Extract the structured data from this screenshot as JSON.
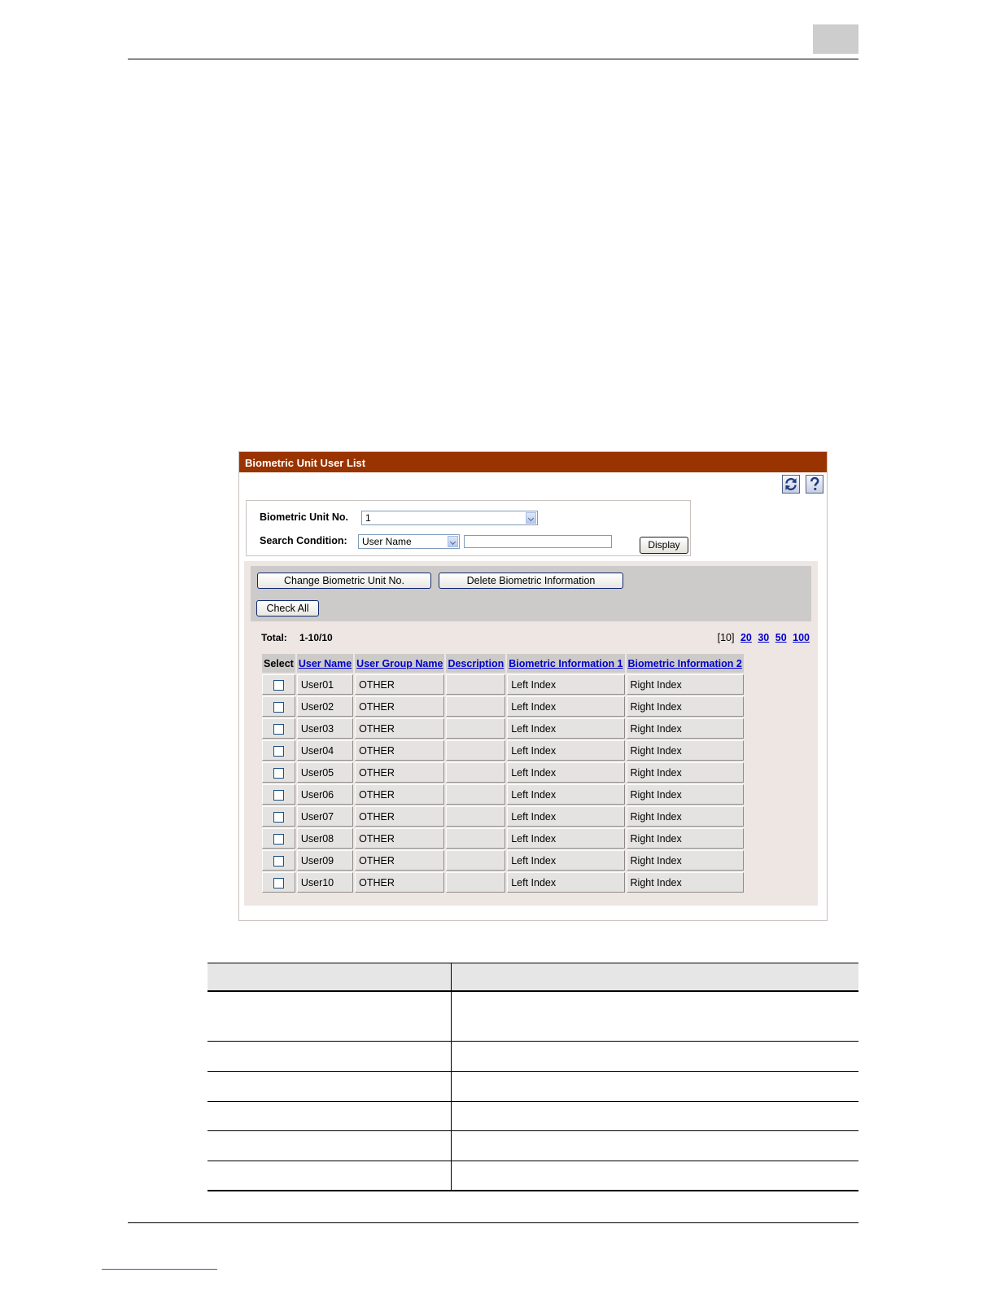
{
  "panel": {
    "title": "Biometric Unit User List",
    "unit_label": "Biometric Unit No.",
    "unit_value": "1",
    "search_label": "Search Condition:",
    "search_option": "User Name",
    "search_text": "",
    "display_label": "Display"
  },
  "toolbar": {
    "change_label": "Change Biometric Unit No.",
    "delete_label": "Delete Biometric Information",
    "check_all_label": "Check All"
  },
  "summary": {
    "total_label": "Total:",
    "total_value": "1-10/10",
    "pager_current": "[10]",
    "pager_links": [
      "20",
      "30",
      "50",
      "100"
    ]
  },
  "table": {
    "columns": [
      "Select",
      "User Name",
      "User Group Name",
      "Description",
      "Biometric Information 1",
      "Biometric Information 2"
    ],
    "rows": [
      {
        "user": "User01",
        "group": "OTHER",
        "desc": "",
        "bio1": "Left Index",
        "bio2": "Right Index"
      },
      {
        "user": "User02",
        "group": "OTHER",
        "desc": "",
        "bio1": "Left Index",
        "bio2": "Right Index"
      },
      {
        "user": "User03",
        "group": "OTHER",
        "desc": "",
        "bio1": "Left Index",
        "bio2": "Right Index"
      },
      {
        "user": "User04",
        "group": "OTHER",
        "desc": "",
        "bio1": "Left Index",
        "bio2": "Right Index"
      },
      {
        "user": "User05",
        "group": "OTHER",
        "desc": "",
        "bio1": "Left Index",
        "bio2": "Right Index"
      },
      {
        "user": "User06",
        "group": "OTHER",
        "desc": "",
        "bio1": "Left Index",
        "bio2": "Right Index"
      },
      {
        "user": "User07",
        "group": "OTHER",
        "desc": "",
        "bio1": "Left Index",
        "bio2": "Right Index"
      },
      {
        "user": "User08",
        "group": "OTHER",
        "desc": "",
        "bio1": "Left Index",
        "bio2": "Right Index"
      },
      {
        "user": "User09",
        "group": "OTHER",
        "desc": "",
        "bio1": "Left Index",
        "bio2": "Right Index"
      },
      {
        "user": "User10",
        "group": "OTHER",
        "desc": "",
        "bio1": "Left Index",
        "bio2": "Right Index"
      }
    ]
  },
  "icons": {
    "refresh": "refresh-icon",
    "help": "help-icon"
  },
  "colors": {
    "header_bg": "#993300",
    "link": "#0000cc"
  }
}
